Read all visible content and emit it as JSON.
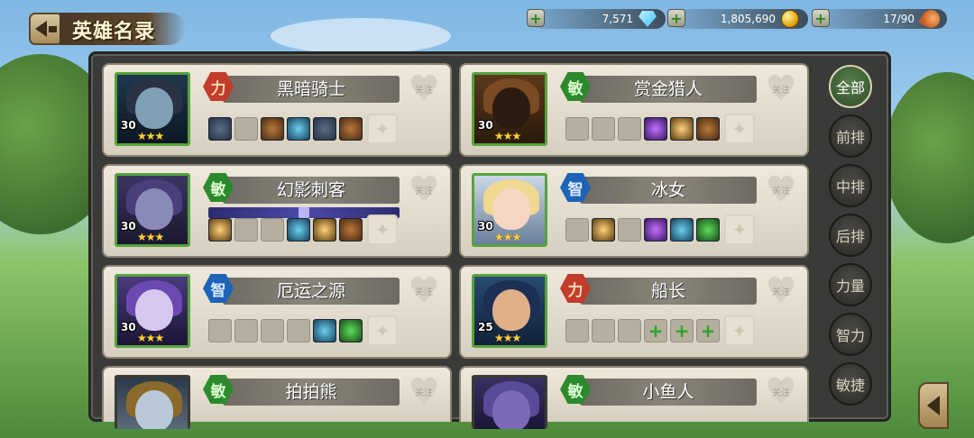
{
  "header": {
    "title": "英雄名录",
    "resources": [
      {
        "name": "diamonds",
        "value": "7,571",
        "icon": "diamond-icon"
      },
      {
        "name": "gold",
        "value": "1,805,690",
        "icon": "gold-coins-icon"
      },
      {
        "name": "stamina",
        "value": "17/90",
        "icon": "drumstick-icon"
      }
    ]
  },
  "heroes": [
    {
      "name": "黑暗骑士",
      "type": "力",
      "level": "30",
      "stars": "★★★",
      "follow": "关注"
    },
    {
      "name": "赏金猎人",
      "type": "敏",
      "level": "30",
      "stars": "★★★",
      "follow": "关注"
    },
    {
      "name": "幻影刺客",
      "type": "敏",
      "level": "30",
      "stars": "★★★",
      "follow": "关注"
    },
    {
      "name": "冰女",
      "type": "智",
      "level": "30",
      "stars": "★★★",
      "follow": "关注"
    },
    {
      "name": "厄运之源",
      "type": "智",
      "level": "30",
      "stars": "★★★",
      "follow": "关注"
    },
    {
      "name": "船长",
      "type": "力",
      "level": "25",
      "stars": "★★★",
      "follow": "关注"
    },
    {
      "name": "拍拍熊",
      "type": "敏",
      "level": "",
      "stars": "",
      "follow": "关注"
    },
    {
      "name": "小鱼人",
      "type": "敏",
      "level": "",
      "stars": "",
      "follow": "关注"
    }
  ],
  "tabs": [
    {
      "label": "全部",
      "active": true
    },
    {
      "label": "前排",
      "active": false
    },
    {
      "label": "中排",
      "active": false
    },
    {
      "label": "后排",
      "active": false
    },
    {
      "label": "力量",
      "active": false
    },
    {
      "label": "智力",
      "active": false
    },
    {
      "label": "敏捷",
      "active": false
    }
  ],
  "equip_plus": "+",
  "colors": {
    "strength": "#c23b2b",
    "agility": "#2c8a2c",
    "intelligence": "#1d63b8",
    "active_tab": "#58804b"
  }
}
